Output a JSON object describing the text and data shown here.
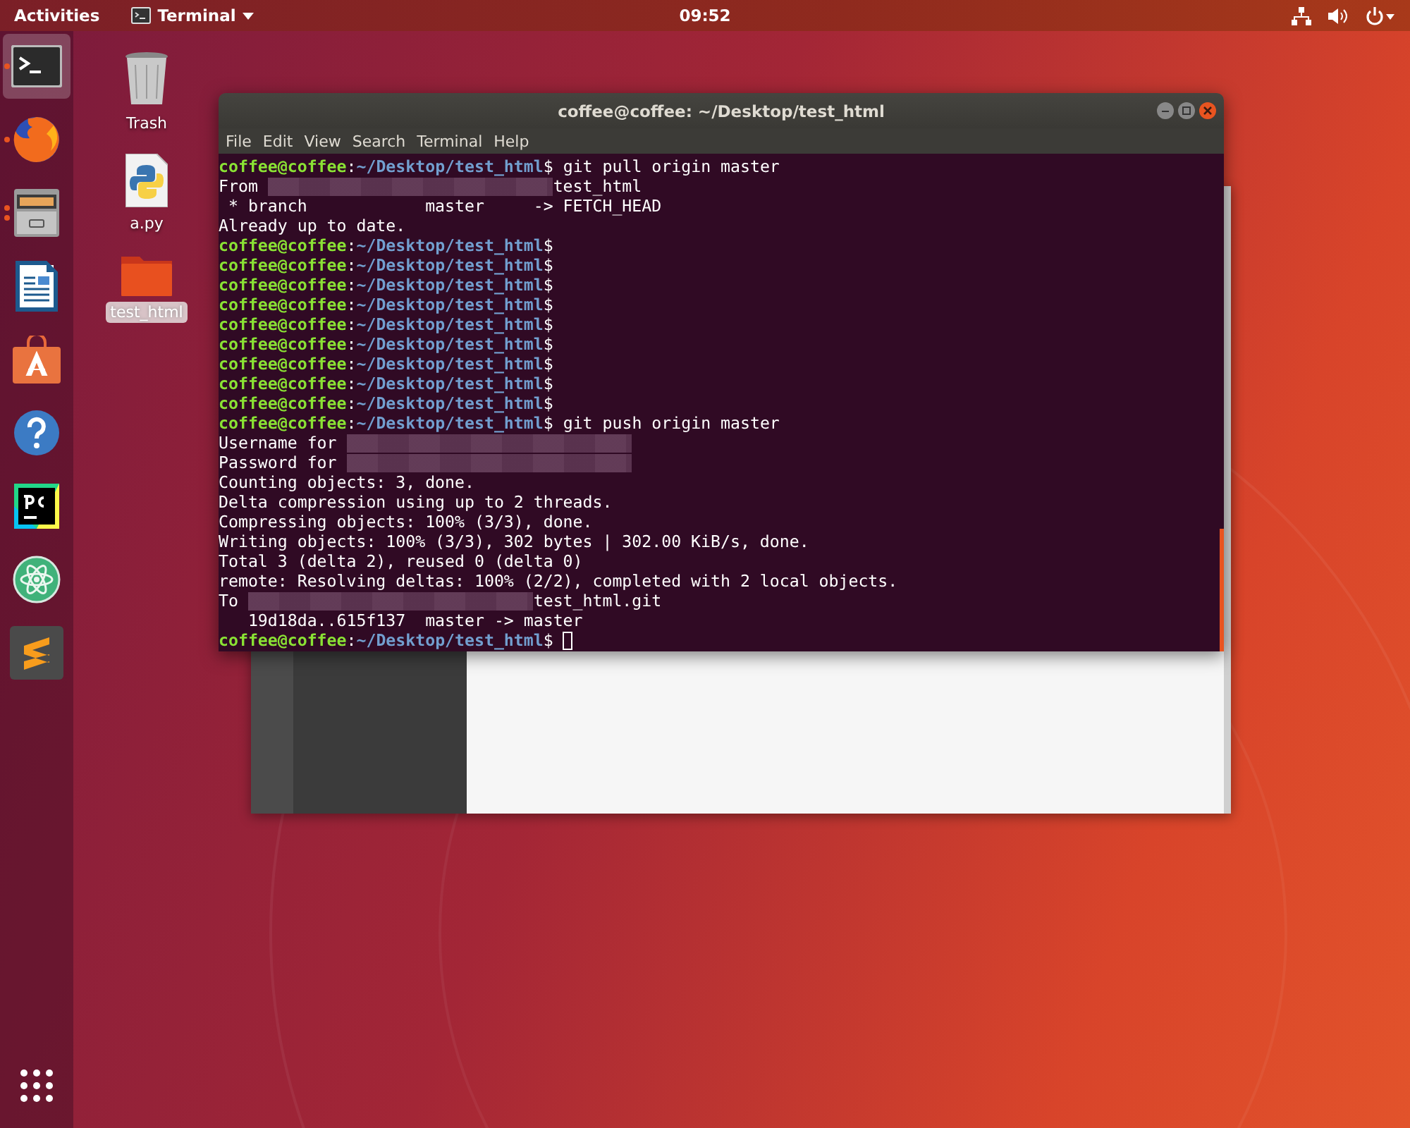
{
  "top_bar": {
    "activities": "Activities",
    "app_menu": "Terminal",
    "clock": "09:52"
  },
  "dock": {
    "items": [
      {
        "kind": "terminal",
        "selected": true,
        "running": true,
        "multiple_windows": false
      },
      {
        "kind": "browser",
        "selected": false,
        "running": true,
        "multiple_windows": false
      },
      {
        "kind": "files",
        "selected": false,
        "running": true,
        "multiple_windows": true
      },
      {
        "kind": "writer",
        "selected": false,
        "running": false,
        "multiple_windows": false
      },
      {
        "kind": "software",
        "selected": false,
        "running": false,
        "multiple_windows": false
      },
      {
        "kind": "help",
        "selected": false,
        "running": false,
        "multiple_windows": false
      },
      {
        "kind": "ide",
        "selected": false,
        "running": false,
        "multiple_windows": false
      },
      {
        "kind": "atom",
        "selected": false,
        "running": false,
        "multiple_windows": false
      },
      {
        "kind": "editor",
        "selected": false,
        "running": false,
        "multiple_windows": false
      }
    ]
  },
  "desktop_icons": [
    {
      "kind": "trash",
      "label": "Trash",
      "selected": false
    },
    {
      "kind": "python",
      "label": "a.py",
      "selected": false
    },
    {
      "kind": "folder",
      "label": "test_html",
      "selected": true
    }
  ],
  "terminal": {
    "title": "coffee@coffee: ~/Desktop/test_html",
    "menu": [
      "File",
      "Edit",
      "View",
      "Search",
      "Terminal",
      "Help"
    ],
    "cursor": true,
    "lines": [
      {
        "kind": "prompt",
        "user": "coffee@coffee",
        "sep": ":",
        "path": "~/Desktop/test_html",
        "sigil": "$",
        "command": "git pull origin master"
      },
      {
        "kind": "output",
        "parts": [
          {
            "kind": "text",
            "text": "From "
          },
          {
            "kind": "redacted"
          },
          {
            "kind": "text",
            "text": "test_html"
          }
        ]
      },
      {
        "kind": "output",
        "parts": [
          {
            "kind": "text",
            "text": " * branch            master     -> FETCH_HEAD"
          }
        ]
      },
      {
        "kind": "output",
        "parts": [
          {
            "kind": "text",
            "text": "Already up to date."
          }
        ]
      },
      {
        "kind": "prompt",
        "user": "coffee@coffee",
        "sep": ":",
        "path": "~/Desktop/test_html",
        "sigil": "$"
      },
      {
        "kind": "prompt",
        "user": "coffee@coffee",
        "sep": ":",
        "path": "~/Desktop/test_html",
        "sigil": "$"
      },
      {
        "kind": "prompt",
        "user": "coffee@coffee",
        "sep": ":",
        "path": "~/Desktop/test_html",
        "sigil": "$"
      },
      {
        "kind": "prompt",
        "user": "coffee@coffee",
        "sep": ":",
        "path": "~/Desktop/test_html",
        "sigil": "$"
      },
      {
        "kind": "prompt",
        "user": "coffee@coffee",
        "sep": ":",
        "path": "~/Desktop/test_html",
        "sigil": "$"
      },
      {
        "kind": "prompt",
        "user": "coffee@coffee",
        "sep": ":",
        "path": "~/Desktop/test_html",
        "sigil": "$"
      },
      {
        "kind": "prompt",
        "user": "coffee@coffee",
        "sep": ":",
        "path": "~/Desktop/test_html",
        "sigil": "$"
      },
      {
        "kind": "prompt",
        "user": "coffee@coffee",
        "sep": ":",
        "path": "~/Desktop/test_html",
        "sigil": "$"
      },
      {
        "kind": "prompt",
        "user": "coffee@coffee",
        "sep": ":",
        "path": "~/Desktop/test_html",
        "sigil": "$"
      },
      {
        "kind": "prompt",
        "user": "coffee@coffee",
        "sep": ":",
        "path": "~/Desktop/test_html",
        "sigil": "$",
        "command": "git push origin master"
      },
      {
        "kind": "output",
        "parts": [
          {
            "kind": "text",
            "text": "Username for "
          },
          {
            "kind": "redacted"
          }
        ]
      },
      {
        "kind": "output",
        "parts": [
          {
            "kind": "text",
            "text": "Password for "
          },
          {
            "kind": "redacted"
          }
        ]
      },
      {
        "kind": "output",
        "parts": [
          {
            "kind": "text",
            "text": "Counting objects: 3, done."
          }
        ]
      },
      {
        "kind": "output",
        "parts": [
          {
            "kind": "text",
            "text": "Delta compression using up to 2 threads."
          }
        ]
      },
      {
        "kind": "output",
        "parts": [
          {
            "kind": "text",
            "text": "Compressing objects: 100% (3/3), done."
          }
        ]
      },
      {
        "kind": "output",
        "parts": [
          {
            "kind": "text",
            "text": "Writing objects: 100% (3/3), 302 bytes | 302.00 KiB/s, done."
          }
        ]
      },
      {
        "kind": "output",
        "parts": [
          {
            "kind": "text",
            "text": "Total 3 (delta 2), reused 0 (delta 0)"
          }
        ]
      },
      {
        "kind": "output",
        "parts": [
          {
            "kind": "text",
            "text": "remote: Resolving deltas: 100% (2/2), completed with 2 local objects."
          }
        ]
      },
      {
        "kind": "output",
        "parts": [
          {
            "kind": "text",
            "text": "To "
          },
          {
            "kind": "redacted"
          },
          {
            "kind": "text",
            "text": "test_html.git"
          }
        ]
      },
      {
        "kind": "output",
        "parts": [
          {
            "kind": "text",
            "text": "   19d18da..615f137  master -> master"
          }
        ]
      },
      {
        "kind": "prompt",
        "user": "coffee@coffee",
        "sep": ":",
        "path": "~/Desktop/test_html",
        "sigil": "$",
        "cursor_here": true
      }
    ]
  }
}
